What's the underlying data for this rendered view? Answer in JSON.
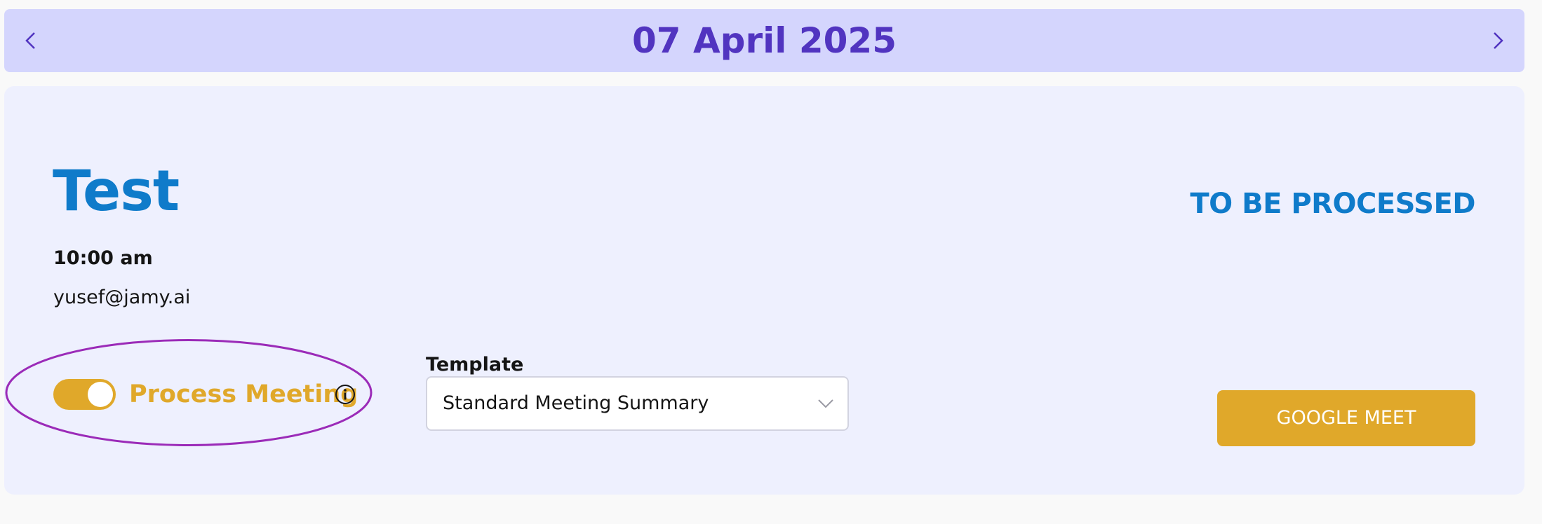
{
  "date_nav": {
    "date": "07 April 2025",
    "prev_icon": "chevron-left-icon",
    "next_icon": "chevron-right-icon"
  },
  "meeting": {
    "title": "Test",
    "time": "10:00 am",
    "email": "yusef@jamy.ai",
    "status": "TO BE PROCESSED"
  },
  "process": {
    "label": "Process Meeting",
    "enabled": true,
    "info_icon": "info-icon"
  },
  "template": {
    "label": "Template",
    "selected": "Standard Meeting Summary"
  },
  "actions": {
    "meet_label": "GOOGLE MEET"
  },
  "colors": {
    "date_bar_bg": "#d4d5fd",
    "date_text": "#5134c0",
    "card_bg": "#eef0fe",
    "title_blue": "#0f7bca",
    "accent_gold": "#e0a82a",
    "highlight_purple": "#9b2bb8"
  }
}
